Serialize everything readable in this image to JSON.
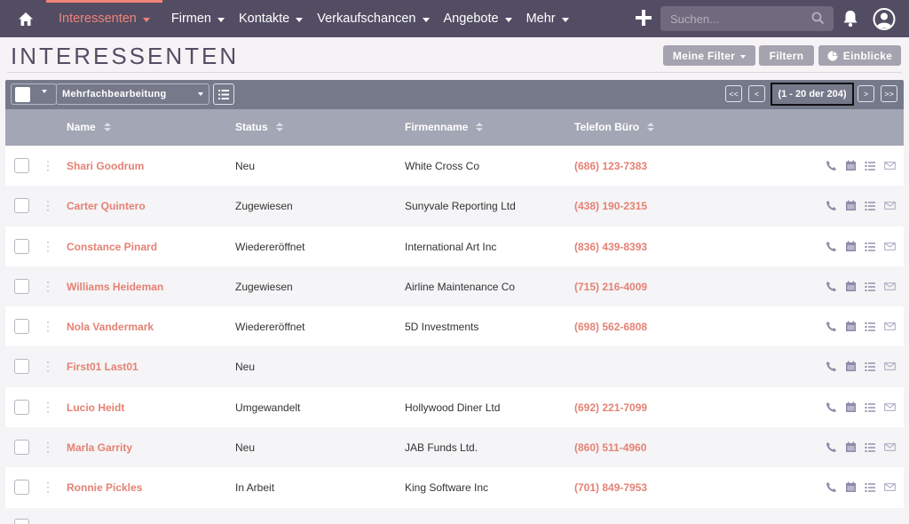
{
  "nav": {
    "items": [
      {
        "label": "Interessenten",
        "active": true
      },
      {
        "label": "Firmen"
      },
      {
        "label": "Kontakte"
      },
      {
        "label": "Verkaufschancen"
      },
      {
        "label": "Angebote"
      },
      {
        "label": "Mehr"
      }
    ],
    "search_placeholder": "Suchen..."
  },
  "page": {
    "title": "INTERESSENTEN",
    "buttons": {
      "filters": "Meine Filter",
      "filter": "Filtern",
      "insights": "Einblicke"
    }
  },
  "toolbar": {
    "mass_update": "Mehrfachbearbeitung",
    "first": "<<",
    "prev": "<",
    "next": ">",
    "last": ">>",
    "count": "(1 - 20 der 204)"
  },
  "table": {
    "columns": [
      "Name",
      "Status",
      "Firmenname",
      "Telefon Büro"
    ],
    "rows": [
      {
        "name": "Shari Goodrum",
        "status": "Neu",
        "company": "White Cross Co",
        "phone": "(686) 123-7383"
      },
      {
        "name": "Carter Quintero",
        "status": "Zugewiesen",
        "company": "Sunyvale Reporting Ltd",
        "phone": "(438) 190-2315"
      },
      {
        "name": "Constance Pinard",
        "status": "Wiedereröffnet",
        "company": "International Art Inc",
        "phone": "(836) 439-8393"
      },
      {
        "name": "Williams Heideman",
        "status": "Zugewiesen",
        "company": "Airline Maintenance Co",
        "phone": "(715) 216-4009"
      },
      {
        "name": "Nola Vandermark",
        "status": "Wiedereröffnet",
        "company": "5D Investments",
        "phone": "(698) 562-6808"
      },
      {
        "name": "First01 Last01",
        "status": "Neu",
        "company": "",
        "phone": ""
      },
      {
        "name": "Lucio Heidt",
        "status": "Umgewandelt",
        "company": "Hollywood Diner Ltd",
        "phone": "(692) 221-7099"
      },
      {
        "name": "Marla Garrity",
        "status": "Neu",
        "company": "JAB Funds Ltd.",
        "phone": "(860) 511-4960"
      },
      {
        "name": "Ronnie Pickles",
        "status": "In Arbeit",
        "company": "King Software Inc",
        "phone": "(701) 849-7953"
      }
    ]
  },
  "colors": {
    "nav_bg": "#534d64",
    "accent": "#f08377",
    "link": "#e48274",
    "toolbar": "#75798a",
    "header": "#a3a6b4"
  },
  "icons": [
    "home-icon",
    "plus-icon",
    "search-icon",
    "bell-icon",
    "user-icon",
    "columns-icon",
    "phone-icon",
    "calendar-icon",
    "task-icon",
    "email-icon"
  ]
}
